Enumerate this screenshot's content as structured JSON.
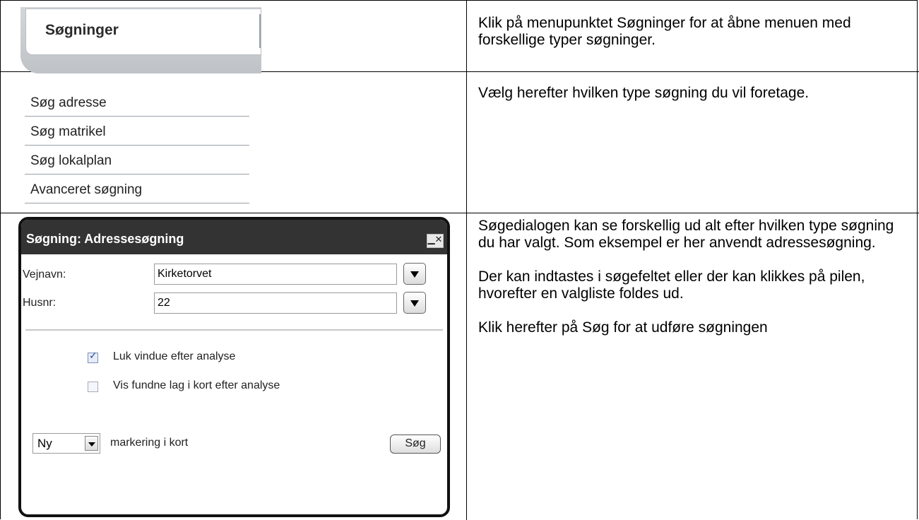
{
  "row1": {
    "menubar_label": "Søgninger",
    "instruction": "Klik på menupunktet Søgninger for at åbne menuen med forskellige typer søgninger."
  },
  "row2": {
    "submenu_items": [
      {
        "label": "Søg adresse"
      },
      {
        "label": "Søg matrikel"
      },
      {
        "label": "Søg lokalplan"
      },
      {
        "label": "Avanceret søgning"
      }
    ],
    "instruction": "Vælg herefter hvilken type søgning du vil foretage."
  },
  "row3": {
    "dialog": {
      "title": "Søgning: Adressesøgning",
      "window_controls": "▁✕",
      "fields": [
        {
          "label": "Vejnavn:",
          "value": "Kirketorvet"
        },
        {
          "label": "Husnr:",
          "value": "22"
        }
      ],
      "checkboxes": [
        {
          "label": "Luk vindue efter analyse",
          "checked": true
        },
        {
          "label": "Vis fundne lag i kort efter analyse",
          "checked": false
        }
      ],
      "mode_select": "Ny",
      "mode_label": "markering i kort",
      "search_button": "Søg"
    },
    "instructions": [
      "Søgedialogen kan se forskellig ud alt efter hvilken type søgning du har valgt. Som eksempel er her anvendt adressesøgning.",
      "Der kan indtastes i søgefeltet eller der kan klikkes på pilen, hvorefter en valgliste foldes ud.",
      "Klik herefter på Søg for at udføre søgningen"
    ]
  }
}
